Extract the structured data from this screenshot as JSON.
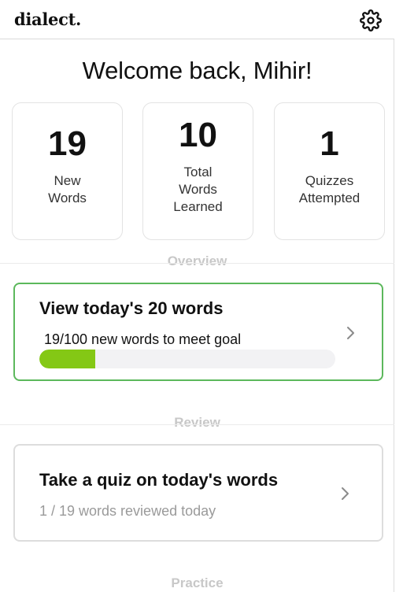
{
  "header": {
    "logo": "dialect.",
    "settings_icon": "gear-icon"
  },
  "welcome": "Welcome back, Mihir!",
  "stats": [
    {
      "value": "19",
      "label_line1": "New",
      "label_line2": "Words"
    },
    {
      "value": "10",
      "label_line1": "Total",
      "label_line2": "Words",
      "label_line3": "Learned"
    },
    {
      "value": "1",
      "label_line1": "Quizzes",
      "label_line2": "Attempted"
    }
  ],
  "sections": {
    "overview": "Overview",
    "review": "Review",
    "practice": "Practice"
  },
  "today_card": {
    "title": "View today's 20 words",
    "goal_text": "19/100 new words to meet goal",
    "progress": 0.19,
    "icon": "chevron-right-icon"
  },
  "quiz_card": {
    "title": "Take a quiz on today's words",
    "subtitle": "1 / 19 words reviewed today",
    "icon": "chevron-right-icon"
  },
  "colors": {
    "accent_green": "#5cb85c",
    "progress_fill": "#84c815",
    "section_label": "#c8c8c8",
    "muted_text": "#9a9a9a"
  }
}
